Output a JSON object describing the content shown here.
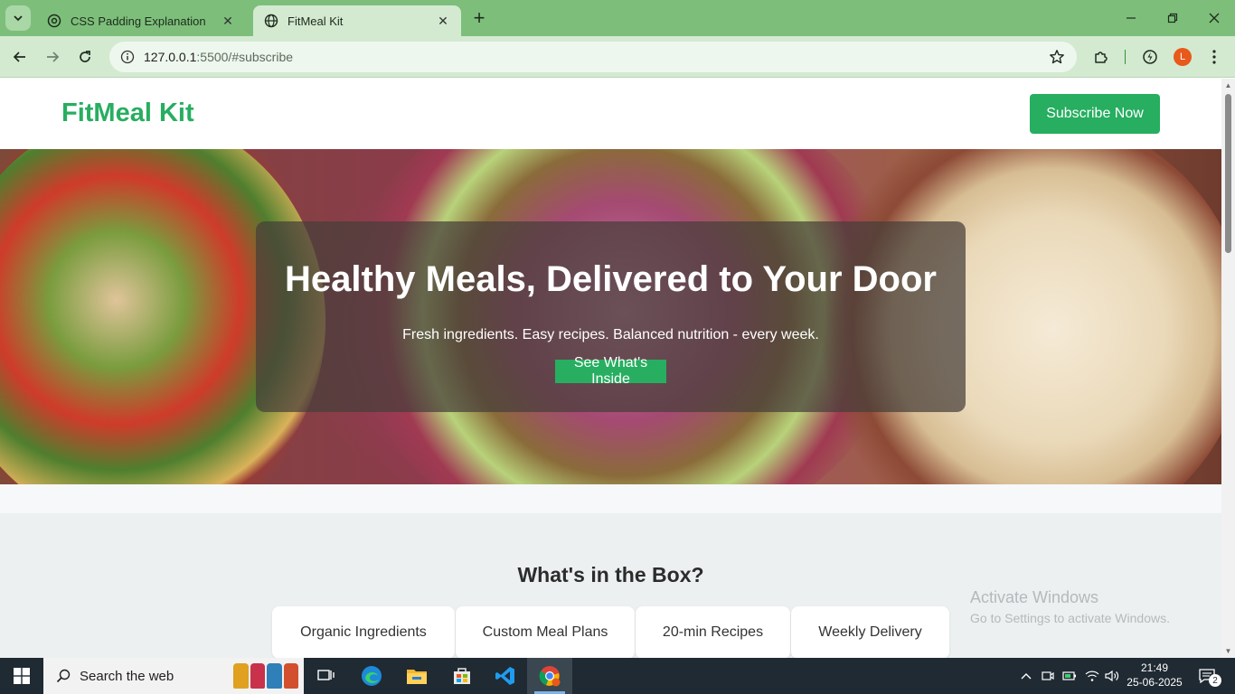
{
  "browser": {
    "tabs": [
      {
        "title": "CSS Padding Explanation",
        "active": false,
        "favicon": "chatgpt-icon"
      },
      {
        "title": "FitMeal Kit",
        "active": true,
        "favicon": "globe-icon"
      }
    ],
    "url_host": "127.0.0.1",
    "url_rest": ":5500/#subscribe",
    "profile_initial": "L",
    "accent_color": "#7dbf7a"
  },
  "site": {
    "logo": "FitMeal Kit",
    "subscribe_label": "Subscribe Now",
    "brand_color": "#27ae60"
  },
  "hero": {
    "title": "Healthy Meals, Delivered to Your Door",
    "subtitle": "Fresh ingredients. Easy recipes. Balanced nutrition - every week.",
    "cta": "See What's Inside"
  },
  "box": {
    "title": "What's in the Box?",
    "features": [
      "Organic Ingredients",
      "Custom Meal Plans",
      "20-min Recipes",
      "Weekly Delivery"
    ]
  },
  "watermark": {
    "line1": "Activate Windows",
    "line2": "Go to Settings to activate Windows."
  },
  "taskbar": {
    "search_placeholder": "Search the web",
    "time": "21:49",
    "date": "25-06-2025",
    "notification_count": "2"
  }
}
